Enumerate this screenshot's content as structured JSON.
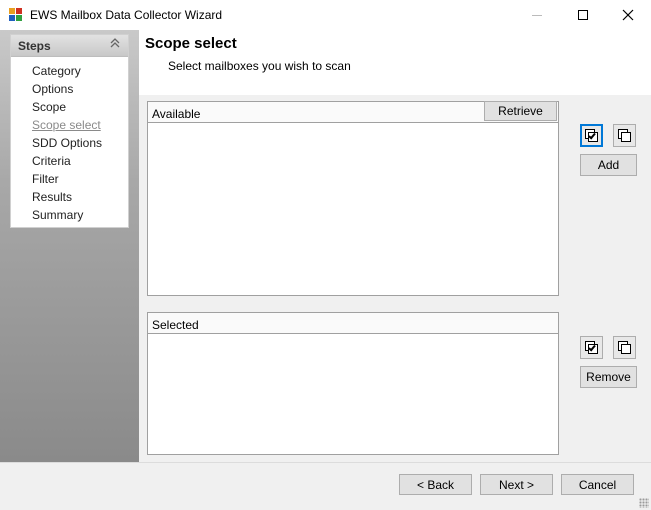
{
  "window": {
    "title": "EWS Mailbox Data Collector Wizard",
    "icon": "app-icon"
  },
  "steps": {
    "header": "Steps",
    "items": [
      {
        "label": "Category"
      },
      {
        "label": "Options"
      },
      {
        "label": "Scope"
      },
      {
        "label": "Scope select",
        "current": true
      },
      {
        "label": "SDD Options"
      },
      {
        "label": "Criteria"
      },
      {
        "label": "Filter"
      },
      {
        "label": "Results"
      },
      {
        "label": "Summary"
      }
    ]
  },
  "page": {
    "title": "Scope select",
    "subtitle": "Select mailboxes you wish to scan"
  },
  "available": {
    "label": "Available",
    "retrieve_label": "Retrieve",
    "add_label": "Add"
  },
  "selected": {
    "label": "Selected",
    "remove_label": "Remove"
  },
  "footer": {
    "back_label": "< Back",
    "next_label": "Next >",
    "cancel_label": "Cancel"
  },
  "colors": {
    "accent": "#0078d7",
    "sidebar_top": "#c9c9c9",
    "sidebar_bottom": "#8a8a8a"
  }
}
